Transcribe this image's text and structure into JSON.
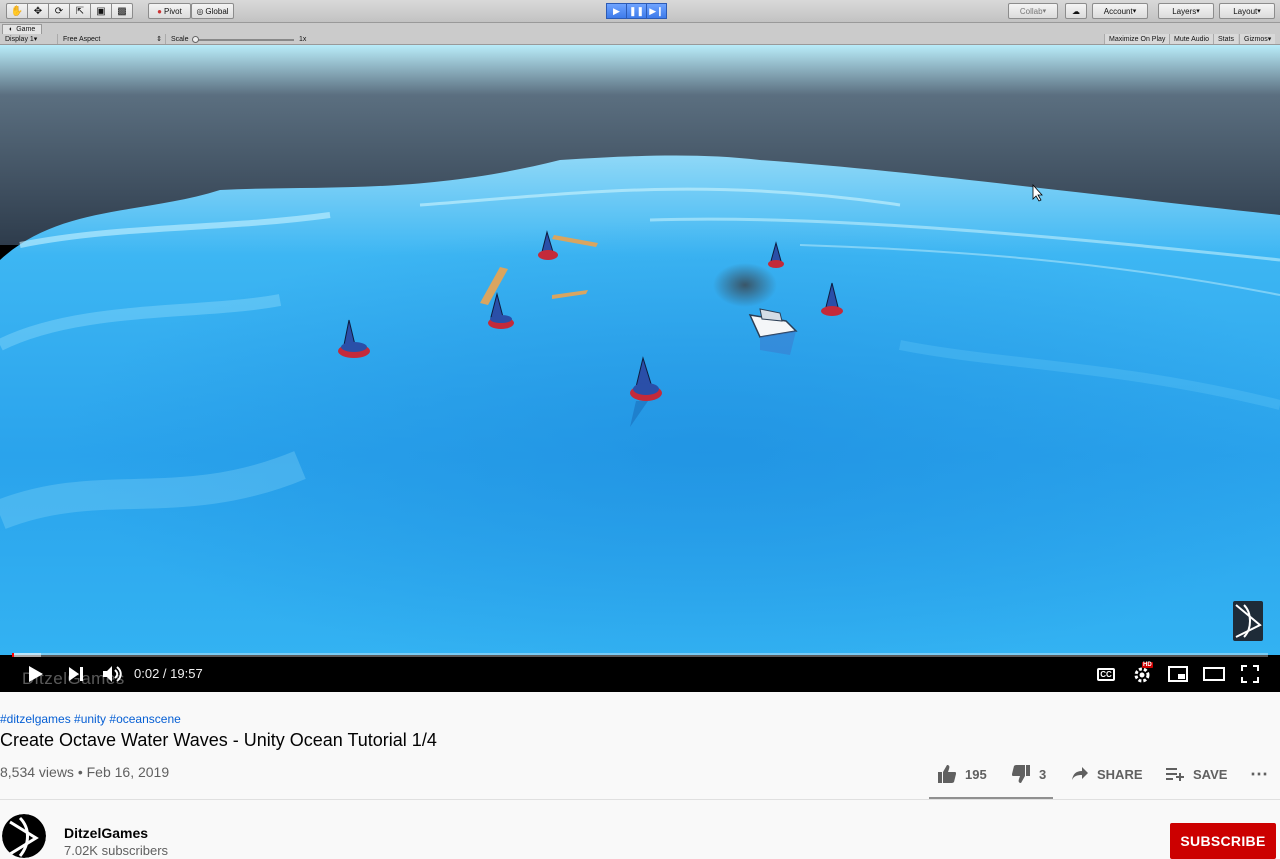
{
  "unity": {
    "tools": [
      "hand-tool-icon",
      "move-tool-icon",
      "rotate-tool-icon",
      "scale-tool-icon",
      "rect-tool-icon",
      "transform-tool-icon"
    ],
    "pivot_label": "Pivot",
    "global_label": "Global",
    "collab_label": "Collab",
    "account_label": "Account",
    "layers_label": "Layers",
    "layout_label": "Layout",
    "game_tab_label": "Game",
    "display_label": "Display 1",
    "aspect_label": "Free Aspect",
    "scale_label": "Scale",
    "scale_value": "1x",
    "maximize_label": "Maximize On Play",
    "mute_label": "Mute Audio",
    "stats_label": "Stats",
    "gizmos_label": "Gizmos"
  },
  "player": {
    "time_display": "0:02 / 19:57",
    "progress_fraction": 0.0017,
    "buffer_fraction": 0.023,
    "watermark_text": "DitzelGames",
    "cc_label": "CC",
    "hd_badge": "HD"
  },
  "video": {
    "hashtags": "#ditzelgames #unity #oceanscene",
    "title": "Create Octave Water Waves - Unity Ocean Tutorial 1/4",
    "views_date": "8,534 views • Feb 16, 2019",
    "likes": "195",
    "dislikes": "3",
    "share_label": "SHARE",
    "save_label": "SAVE"
  },
  "channel": {
    "name": "DitzelGames",
    "subscribers": "7.02K subscribers",
    "subscribe_label": "SUBSCRIBE"
  },
  "colors": {
    "subscribe": "#cc0000",
    "link": "#065fd4",
    "progress": "#ff0000",
    "ocean": "#2aa9f0"
  }
}
